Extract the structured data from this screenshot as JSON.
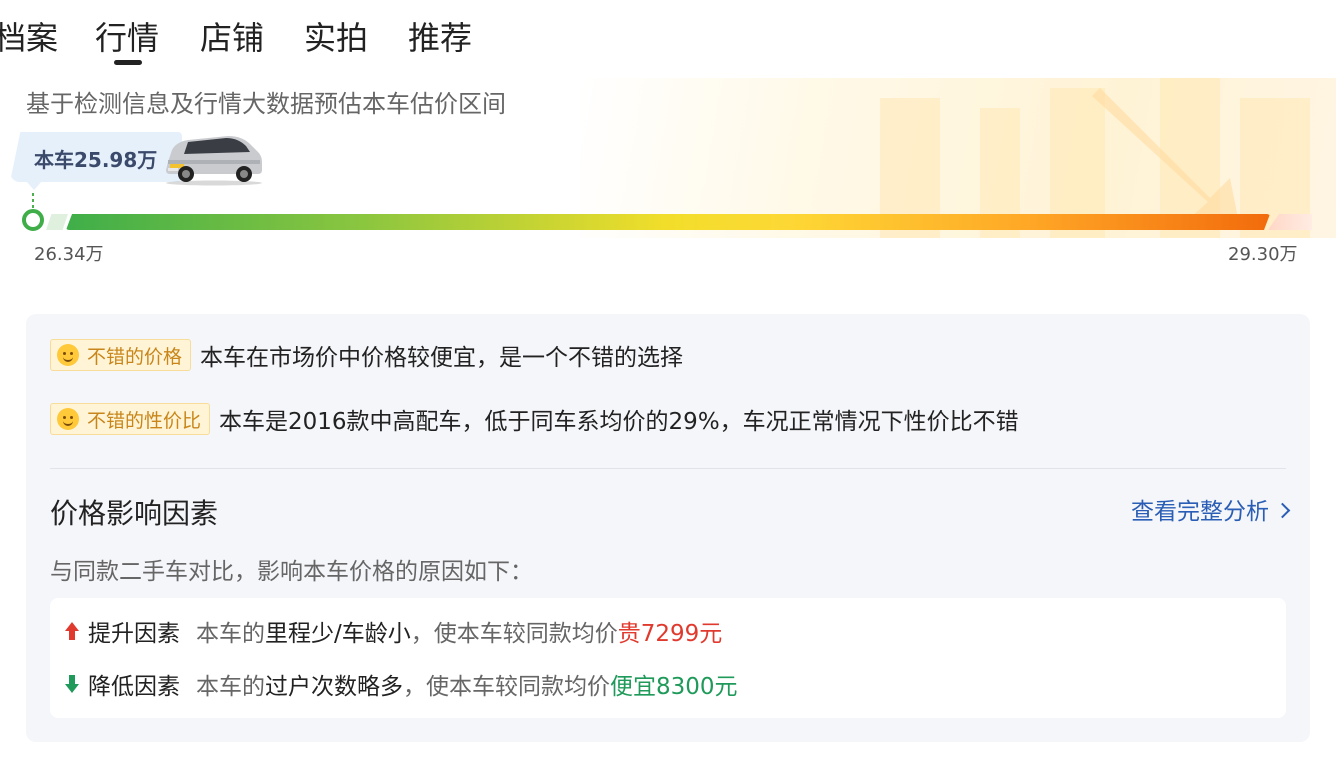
{
  "tabs": [
    {
      "label": "档案"
    },
    {
      "label": "行情"
    },
    {
      "label": "店铺"
    },
    {
      "label": "实拍"
    },
    {
      "label": "推荐"
    }
  ],
  "active_tab": "行情",
  "price_section": {
    "subtitle": "基于检测信息及行情大数据预估本车估价区间",
    "marker_label": "本车25.98万",
    "range_min": "26.34万",
    "range_max": "29.30万"
  },
  "evaluations": [
    {
      "tag": "不错的价格",
      "text": "本车在市场价中价格较便宜，是一个不错的选择",
      "icon": "smile-icon"
    },
    {
      "tag": "不错的性价比",
      "text": "本车是2016款中高配车，低于同车系均价的29%，车况正常情况下性价比不错",
      "icon": "smile-icon"
    }
  ],
  "factors": {
    "title": "价格影响因素",
    "link_label": "查看完整分析",
    "description": "与同款二手车对比，影响本车价格的原因如下：",
    "items": [
      {
        "direction": "up",
        "icon": "arrow-up-icon",
        "label": "提升因素",
        "prefix": "本车的",
        "reason": "里程少/车龄小",
        "middle": "，使本车较同款均价",
        "value": "贵7299元"
      },
      {
        "direction": "down",
        "icon": "arrow-down-icon",
        "label": "降低因素",
        "prefix": "本车的",
        "reason": "过户次数略多",
        "middle": "，使本车较同款均价",
        "value": "便宜8300元"
      }
    ]
  },
  "colors": {
    "gauge_start": "#3fae49",
    "gauge_mid": "#fdd835",
    "gauge_end": "#f26b0c",
    "link": "#2a5db5",
    "increase": "#e03a2e",
    "decrease": "#1f9a5a",
    "tag_text": "#c8861a"
  }
}
